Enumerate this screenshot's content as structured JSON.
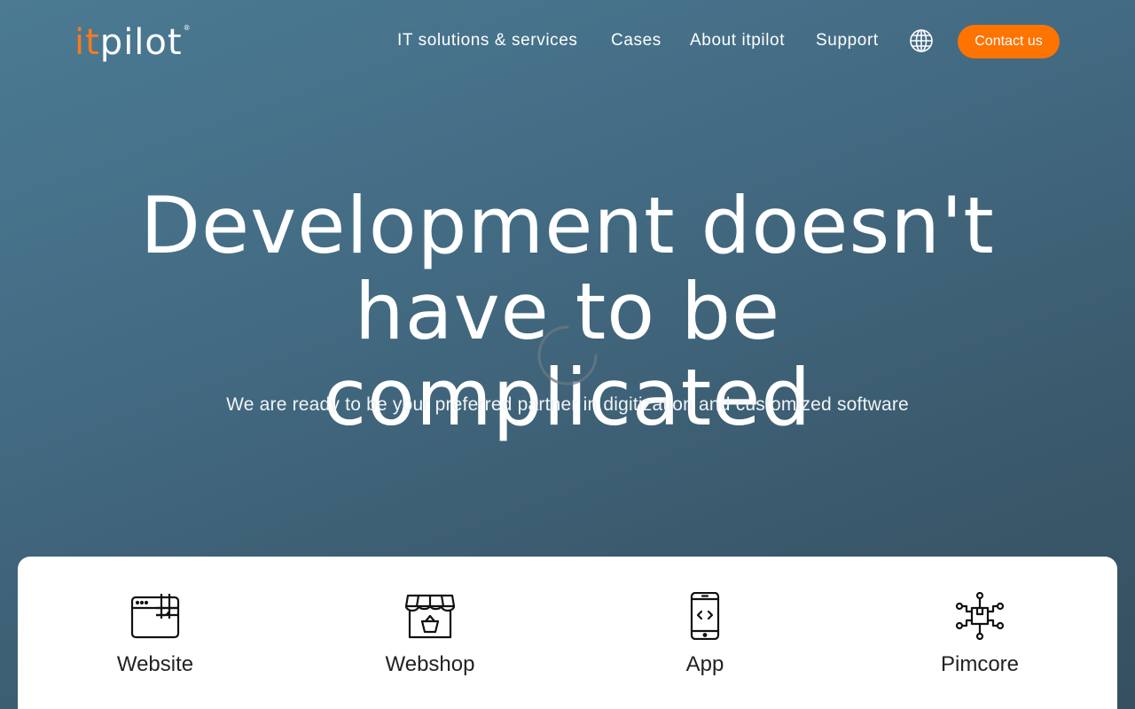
{
  "brand": {
    "logo_it": "it",
    "logo_pilot": "pilot",
    "logo_reg": "®",
    "accent": "#ff7300"
  },
  "nav": {
    "items": [
      {
        "label": "IT solutions & services"
      },
      {
        "label": "Cases"
      },
      {
        "label": "About itpilot"
      },
      {
        "label": "Support"
      }
    ],
    "language_icon": "globe-icon",
    "contact_label": "Contact us"
  },
  "hero": {
    "title_line1": "Development doesn't",
    "title_line2": "have to be complicated",
    "subtitle": "We are ready to be your preferred partner in digitization and customized software"
  },
  "services": [
    {
      "label": "Website",
      "icon": "browser-window-icon"
    },
    {
      "label": "Webshop",
      "icon": "shop-basket-icon"
    },
    {
      "label": "App",
      "icon": "smartphone-code-icon"
    },
    {
      "label": "Pimcore",
      "icon": "network-box-icon"
    }
  ]
}
